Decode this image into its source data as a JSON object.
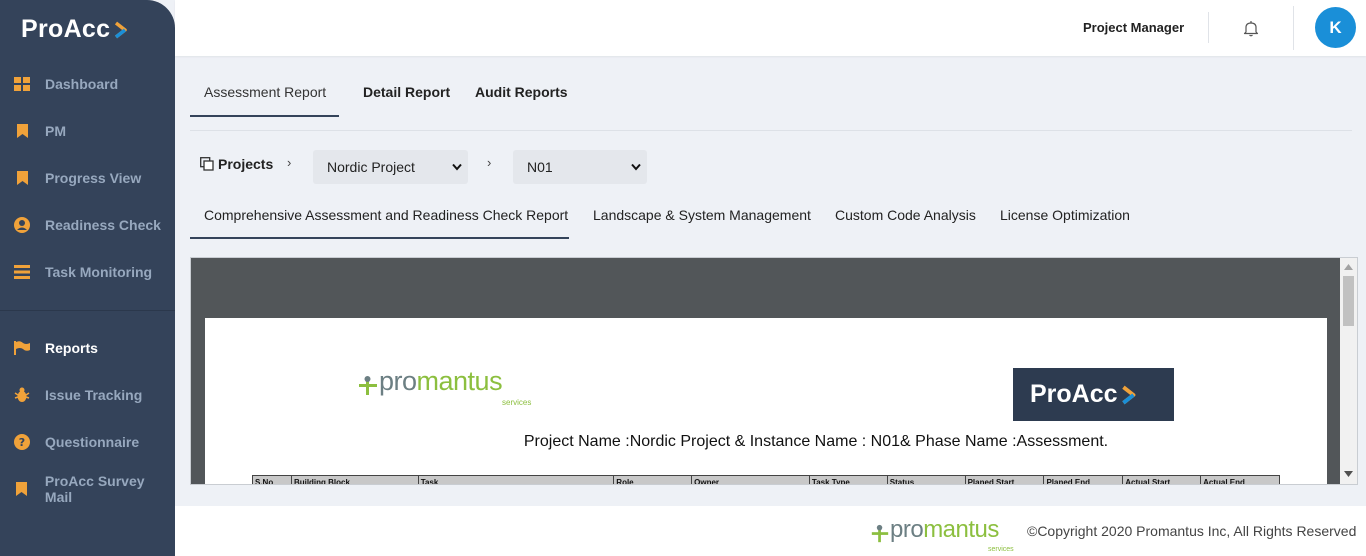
{
  "brand": {
    "name": "ProAcc"
  },
  "sidebar": {
    "items": [
      {
        "label": "Dashboard",
        "icon": "dashboard-grid-icon"
      },
      {
        "label": "PM",
        "icon": "bookmark-icon"
      },
      {
        "label": "Progress View",
        "icon": "bookmark-icon"
      },
      {
        "label": "Readiness Check",
        "icon": "user-circle-icon"
      },
      {
        "label": "Task Monitoring",
        "icon": "tasks-icon"
      },
      {
        "label": "Reports",
        "icon": "flag-icon",
        "active": true
      },
      {
        "label": "Issue Tracking",
        "icon": "bug-icon"
      },
      {
        "label": "Questionnaire",
        "icon": "question-circle-icon"
      },
      {
        "label": "ProAcc Survey Mail",
        "icon": "bookmark-icon"
      }
    ]
  },
  "header": {
    "role": "Project Manager",
    "avatar_initial": "K"
  },
  "tabs": [
    "Assessment Report",
    "Detail Report",
    "Audit Reports"
  ],
  "breadcrumb": {
    "projects_label": "Projects",
    "sep": "›",
    "project": "Nordic Project",
    "instance": "N01"
  },
  "subtabs": [
    "Comprehensive Assessment and Readiness Check Report",
    "Landscape & System Management",
    "Custom Code Analysis",
    "License Optimization"
  ],
  "report": {
    "logo_left": {
      "pro": "pro",
      "mantus": "mantus",
      "tagline": "services"
    },
    "logo_right": "ProAcc",
    "title": "Project Name :Nordic Project & Instance Name : N01& Phase Name :Assessment.",
    "columns": [
      "S.No",
      "Building Block",
      "Task",
      "Role",
      "Owner",
      "Task Type",
      "Status",
      "Planed Start",
      "Planed End",
      "Actual Start",
      "Actual End"
    ]
  },
  "footer": {
    "logo": {
      "pro": "pro",
      "mantus": "mantus",
      "tagline": "services"
    },
    "copyright": "©Copyright 2020 Promantus Inc, All Rights Reserved"
  },
  "colors": {
    "sidebar": "#34435a",
    "accent": "#1a8fd8",
    "icon_orange": "#f0a23a",
    "brand_green": "#8cbf3f"
  }
}
